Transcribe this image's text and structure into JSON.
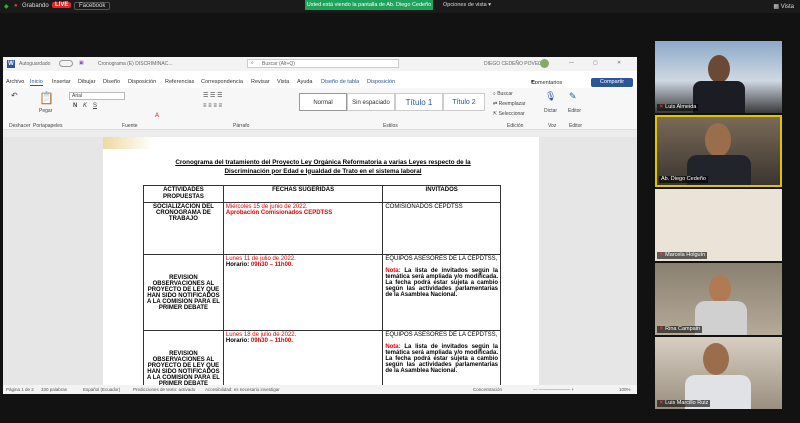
{
  "zoom": {
    "recording_label": "Grabando",
    "live_label": "LIVE",
    "facebook_label": "Facebook",
    "share_banner": "Usted está viendo la pantalla de Ab. Diego Cedeño",
    "view_options": "Opciones de vista",
    "view_label": "Vista"
  },
  "word": {
    "autosave": "Autoguardado",
    "title": "Cronograma (E) DISCRIMINAC...",
    "search_placeholder": "Buscar (Alt+Q)",
    "user": "DIEGO CEDEÑO POVEDA",
    "menu": [
      "Archivo",
      "Inicio",
      "Insertar",
      "Dibujar",
      "Diseño",
      "Disposición",
      "Referencias",
      "Correspondencia",
      "Revisar",
      "Vista",
      "Ayuda",
      "Diseño de tabla",
      "Disposición"
    ],
    "comments": "Comentarios",
    "share": "Compartir",
    "ribbon": {
      "paste": "Pegar",
      "clipboard": "Portapapeles",
      "undo": "Deshacer",
      "font_name": "Arial",
      "font_group": "Fuente",
      "paragraph_group": "Párrafo",
      "styles_group": "Estilos",
      "style_normal": "Normal",
      "style_nospace": "Sin espaciado",
      "style_t1": "Título 1",
      "style_t2": "Título 2",
      "find": "Buscar",
      "replace": "Reemplazar",
      "select": "Seleccionar",
      "edit_group": "Edición",
      "dictate": "Dictar",
      "voice_group": "Voz",
      "editor": "Editor",
      "editor_group": "Editor"
    },
    "status": {
      "page": "Página 1 de 2",
      "words": "330 palabras",
      "lang": "Español (Ecuador)",
      "predict": "Predicciones de texto: activado",
      "access": "Accesibilidad: es necesario investigar",
      "focus": "Concentración",
      "zoom": "100%"
    }
  },
  "doc": {
    "title": "Cronograma del tratamiento del Proyecto Ley Orgánica Reformatoria a varias Leyes respecto de la Discriminación por Edad e Igualdad de Trato en el sistema laboral",
    "headers": [
      "ACTIVIDADES PROPUESTAS",
      "FECHAS SUGERIDAS",
      "INVITADOS"
    ],
    "rows": [
      {
        "activity": "SOCIALIZACIÓN DEL CRONOGRAMA DE TRABAJO",
        "date": "Miércoles 15 de junio de 2022.",
        "detail": "Aprobación Comisionados CEPDTSS",
        "guests": "COMISIONADOS CEPDTSS"
      },
      {
        "activity": "REVISION OBSERVACIONES AL PROYECTO DE LEY QUE HAN SIDO NOTIFICADOS A LA COMISION PARA EL PRIMER DEBATE",
        "date": "Lunes 11 de julio de 2022.",
        "hour_label": "Horario: ",
        "hour": "09h30 – 11h00.",
        "guests": "EQUIPOS ASESORES DE LA CEPDTSS,",
        "note_label": "Nota:",
        "note": " La lista de invitados según la temática será ampliada y/o modificada. La fecha podrá estar sujeta a cambio según las actividades parlamentarias de la Asamblea Nacional."
      },
      {
        "activity": "REVISION OBSERVACIONES AL PROYECTO DE LEY QUE HAN SIDO NOTIFICADOS A LA COMISION PARA EL PRIMER DEBATE",
        "date": "Lunes 18 de julio de 2022.",
        "hour_label": "Horario: ",
        "hour": "09h30 – 11h00.",
        "guests": "EQUIPOS ASESORES DE LA CEPDTSS,",
        "note_label": "Nota:",
        "note": " La lista de invitados según la temática será ampliada y/o modificada. La fecha podrá estar sujeta a cambio según las actividades parlamentarias de la Asamblea Nacional."
      }
    ]
  },
  "participants": [
    {
      "name": "Luis Almeida"
    },
    {
      "name": "Ab. Diego Cedeño"
    },
    {
      "name": "Marcela Holguín"
    },
    {
      "name": "Rina Campain"
    },
    {
      "name": "Luis Marcillo Ruiz"
    }
  ]
}
